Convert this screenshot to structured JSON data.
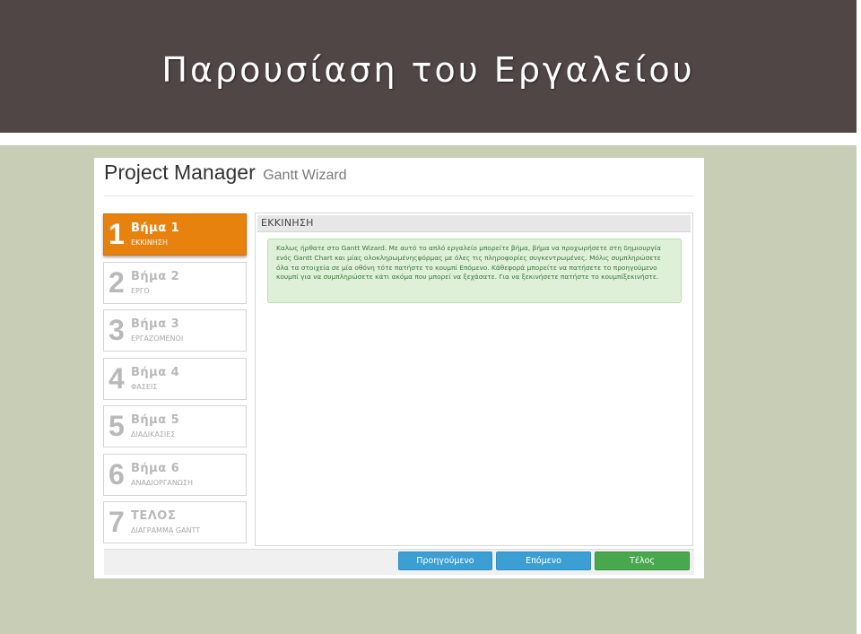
{
  "slide": {
    "title": "Παρουσίαση του Εργαλείου"
  },
  "app": {
    "title": "Project Manager",
    "subtitle": "Gantt Wizard"
  },
  "steps": [
    {
      "num": "1",
      "name": "Βήμα 1",
      "desc": "ΕΚΚΙΝΗΣΗ",
      "active": true
    },
    {
      "num": "2",
      "name": "Βήμα 2",
      "desc": "ΕΡΓΟ"
    },
    {
      "num": "3",
      "name": "Βήμα 3",
      "desc": "ΕΡΓΑΖΟΜΕΝΟΙ"
    },
    {
      "num": "4",
      "name": "Βήμα 4",
      "desc": "ΦΑΣΕΙΣ"
    },
    {
      "num": "5",
      "name": "Βήμα 5",
      "desc": "ΔΙΑΔΙΚΑΣΙΕΣ"
    },
    {
      "num": "6",
      "name": "Βήμα 6",
      "desc": "ΑΝΑΔΙΟΡΓΑΝΩΣΗ"
    },
    {
      "num": "7",
      "name": "ΤΕΛΟΣ",
      "desc": "ΔΙΑΓΡΑΜΜΑ GANTT"
    }
  ],
  "content": {
    "header": "ΕΚΚΙΝΗΣΗ",
    "message": "Καλως ήρθατε στο Gantt Wizard. Με αυτό το απλό εργαλείο μπορείτε βήμα, βήμα να προχωρήσετε στη δημιουργία ενός Gantt Chart και μίας ολοκληρωμένηςφόρμας με όλες τις πληροφορίες συγκεντρωμένες. Μόλις συμπληρώσετε όλα τα στοιχεία σε μία οθόνη τότε πατήστε το κουμπί Επόμενο. Κάθεφορά μπορείτε να πατήσετε το προηγούμενο κουμπί για να συμπληρώσετε κάτι ακόμα που μπορεί να ξεχάσατε. Για να ξεκινήσετε πατήστε το κουμπίξεκινήστε."
  },
  "buttons": {
    "prev": "Προηγούμενο",
    "next": "Επόμενο",
    "finish": "Τέλος"
  },
  "colors": {
    "active_step": "#e8820e",
    "primary_button": "#3c9fd4",
    "finish_button": "#48a84d",
    "header_bg": "#514646",
    "slide_bg": "#c8cdb5"
  }
}
